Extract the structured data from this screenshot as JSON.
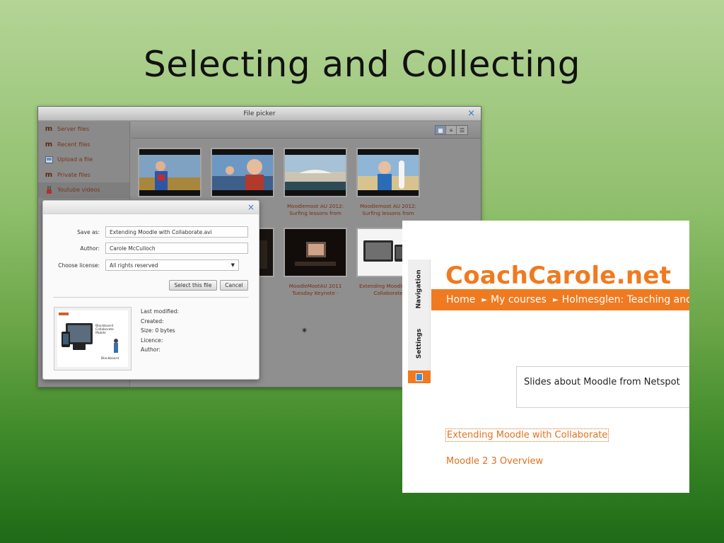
{
  "slide": {
    "title": "Selecting and Collecting"
  },
  "file_picker": {
    "title": "File picker",
    "close_label": "×",
    "repositories": [
      {
        "label": "Server files",
        "icon": "moodle-icon"
      },
      {
        "label": "Recent files",
        "icon": "moodle-icon"
      },
      {
        "label": "Upload a file",
        "icon": "upload-icon"
      },
      {
        "label": "Private files",
        "icon": "moodle-icon"
      },
      {
        "label": "Youtube videos",
        "icon": "youtube-icon"
      }
    ],
    "view_modes": [
      {
        "icon": "icons-view-icon",
        "glyph": "▦",
        "active": true
      },
      {
        "icon": "list-view-icon",
        "glyph": "≡",
        "active": false
      },
      {
        "icon": "tree-view-icon",
        "glyph": "☰",
        "active": false
      }
    ],
    "thumbnails": [
      {
        "caption": ""
      },
      {
        "caption": "Moodlemoot AU 2012: Surfing lessons from"
      },
      {
        "caption": "Moodlemoot AU 2012: Surfing lessons from"
      },
      {
        "caption": "Moodlemoot AU 2012: Surfing lessons from"
      },
      {
        "caption": ""
      },
      {
        "caption": "MoodleMootAU 2011"
      },
      {
        "caption": "MoodleMootAU 2011 Tuesday Keynote -"
      },
      {
        "caption": "Extending Moodle with Collaborate"
      }
    ],
    "partial_captions": [
      "12:",
      "om"
    ],
    "partial_caption_2": "11",
    "spinner": "✷"
  },
  "save_dialog": {
    "close_label": "×",
    "save_as_label": "Save as:",
    "save_as_value": "Extending Moodle with Collaborate.avi",
    "author_label": "Author:",
    "author_value": "Carole McCulloch",
    "license_label": "Choose license:",
    "license_value": "All rights reserved",
    "select_button": "Select this file",
    "cancel_button": "Cancel",
    "meta": {
      "last_modified": "Last modified:",
      "created": "Created:",
      "size": "Size: 0 bytes",
      "licence": "Licence:",
      "author": "Author:"
    },
    "preview": {
      "title": "Blackboard Collaborate Mobile",
      "brand": "Blackboard"
    }
  },
  "coachcarole": {
    "logo": "CoachCarole.net",
    "dock_tabs": [
      "Navigation",
      "Settings"
    ],
    "breadcrumb": [
      "Home",
      "My courses",
      "Holmesglen: Teaching and"
    ],
    "block_text": "Slides about Moodle from Netspot",
    "links": [
      "Extending Moodle with Collaborate",
      "Moodle 2 3 Overview"
    ]
  },
  "colors": {
    "accent": "#f07a20",
    "link": "#e2701e",
    "repo_link": "#7a3418"
  }
}
